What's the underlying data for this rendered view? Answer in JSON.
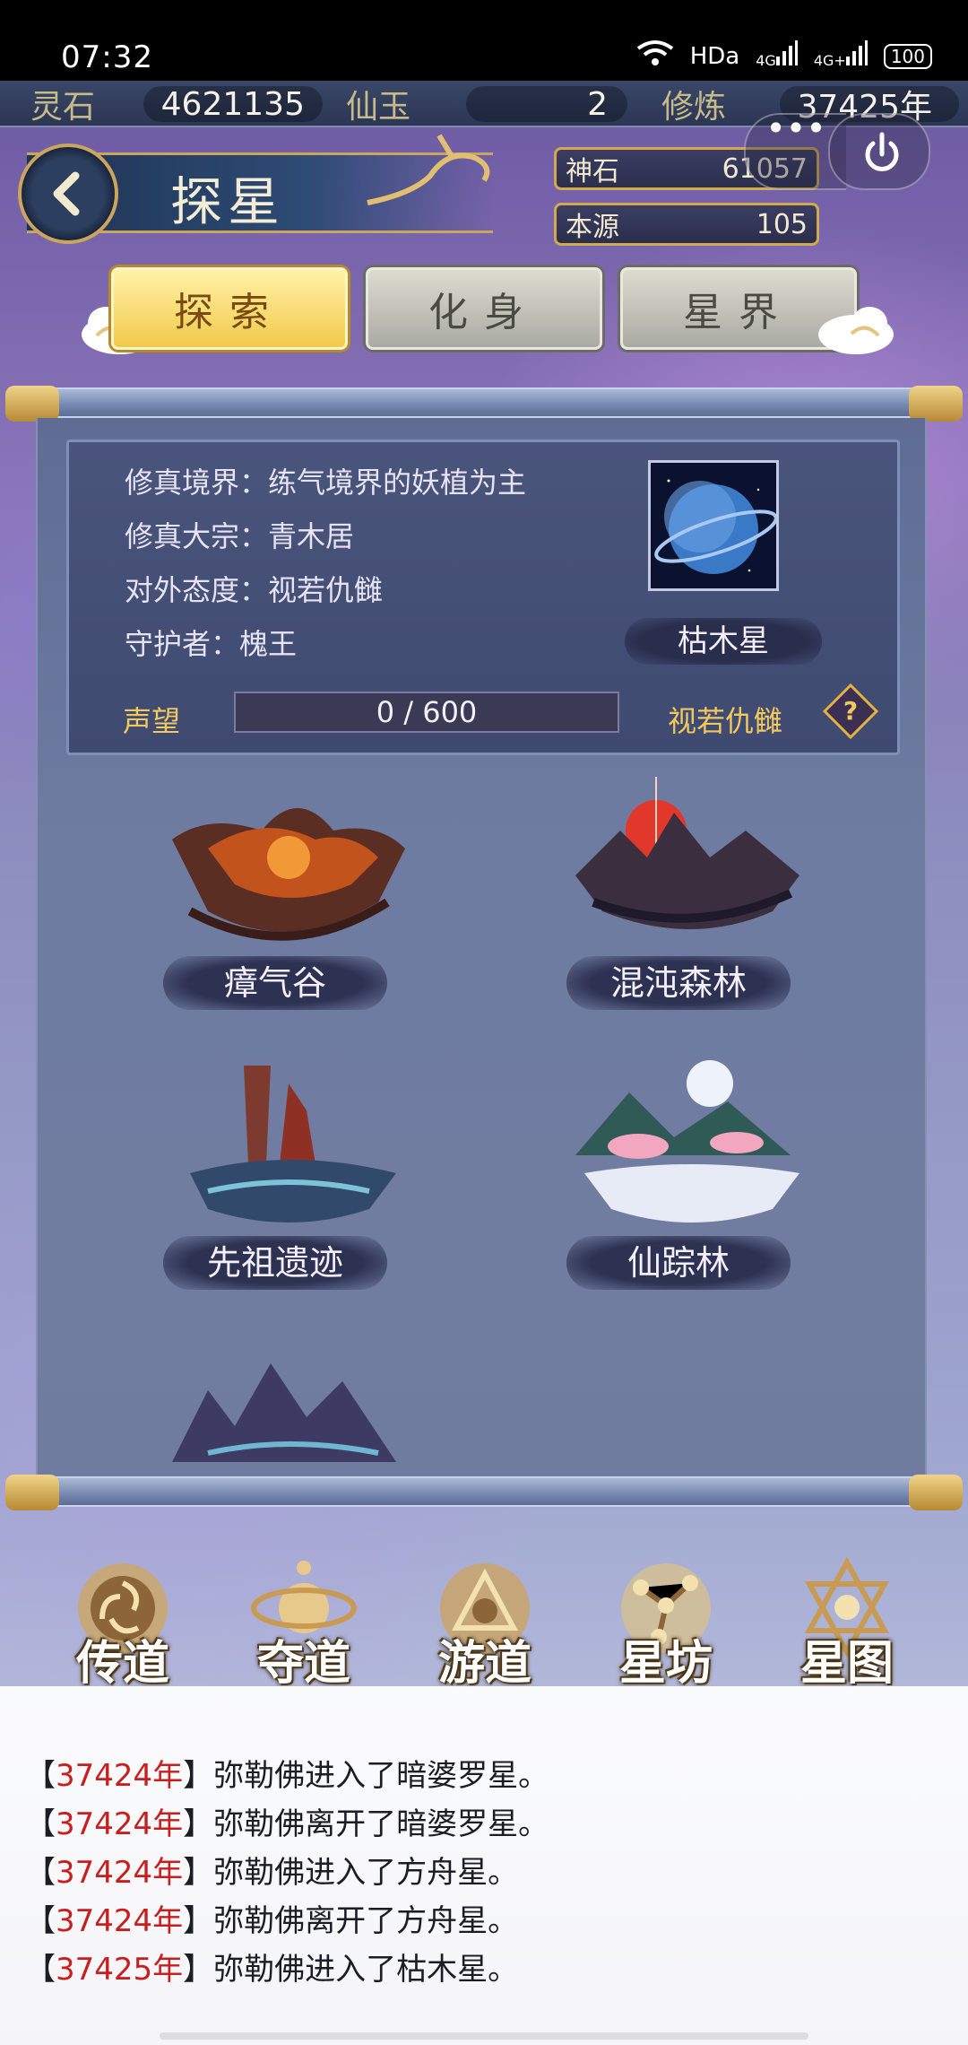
{
  "status_bar": {
    "time": "07:32",
    "network": "HDa",
    "signal1": "4G",
    "signal2": "4G+",
    "battery": "100"
  },
  "resources": [
    {
      "label": "灵石",
      "value": "4621135"
    },
    {
      "label": "仙玉",
      "value": "2"
    },
    {
      "label": "修炼",
      "value": "37425年"
    }
  ],
  "header": {
    "title": "探星",
    "menu_dots": "•••"
  },
  "currencies": [
    {
      "label": "神石",
      "value": "61057"
    },
    {
      "label": "本源",
      "value": "105"
    }
  ],
  "tabs": [
    {
      "label": "探索",
      "active": true
    },
    {
      "label": "化身",
      "active": false
    },
    {
      "label": "星界",
      "active": false
    }
  ],
  "star_info": {
    "realm": "修真境界：练气境界的妖植为主",
    "sect": "修真大宗：青木居",
    "attitude": "对外态度：视若仇雠",
    "guardian": "守护者：槐王",
    "planet_name": "枯木星",
    "reputation_label": "声望",
    "reputation_text": "0 / 600",
    "reputation_progress": 0,
    "reputation_status": "视若仇雠",
    "help_glyph": "?"
  },
  "locations": [
    {
      "name": "瘴气谷"
    },
    {
      "name": "混沌森林"
    },
    {
      "name": "先祖遗迹"
    },
    {
      "name": "仙踪林"
    },
    {
      "name": ""
    }
  ],
  "dock": [
    {
      "label": "传道"
    },
    {
      "label": "夺道"
    },
    {
      "label": "游道"
    },
    {
      "label": "星坊"
    },
    {
      "label": "星图"
    }
  ],
  "log": [
    {
      "year": "37424年",
      "text": "弥勒佛进入了暗婆罗星。"
    },
    {
      "year": "37424年",
      "text": "弥勒佛离开了暗婆罗星。"
    },
    {
      "year": "37424年",
      "text": "弥勒佛进入了方舟星。"
    },
    {
      "year": "37424年",
      "text": "弥勒佛离开了方舟星。"
    },
    {
      "year": "37425年",
      "text": "弥勒佛进入了枯木星。"
    }
  ],
  "colors": {
    "accent_gold": "#f1c85e",
    "log_year": "#c81e1e",
    "tab_active": "#f2c94a"
  }
}
